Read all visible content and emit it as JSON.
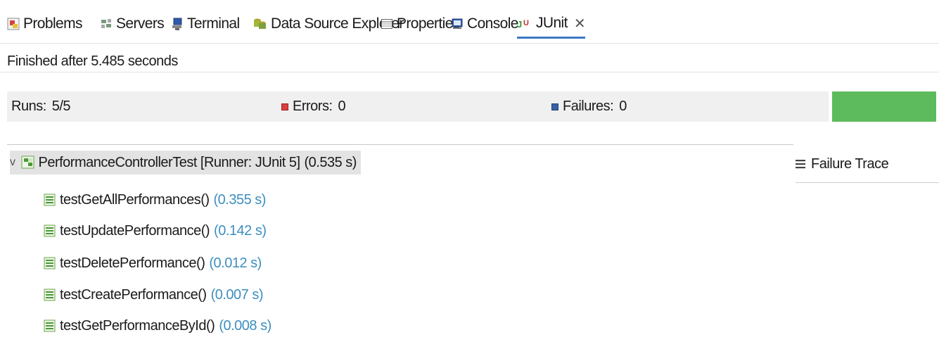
{
  "tabs": [
    {
      "label": "Problems",
      "icon": "problems-icon"
    },
    {
      "label": "Servers",
      "icon": "servers-icon"
    },
    {
      "label": "Terminal",
      "icon": "terminal-icon"
    },
    {
      "label": "Data Source Explorer",
      "icon": "data-source-icon"
    },
    {
      "label": "Properties",
      "icon": "properties-icon"
    },
    {
      "label": "Console",
      "icon": "console-icon"
    },
    {
      "label": "JUnit",
      "icon": "junit-icon",
      "active": true,
      "close": "✕"
    }
  ],
  "status": "Finished after 5.485 seconds",
  "counters": {
    "runs_label": "Runs:",
    "runs_value": "5/5",
    "errors_label": "Errors:",
    "errors_value": "0",
    "failures_label": "Failures:",
    "failures_value": "0"
  },
  "progress": {
    "fraction": 1.0,
    "color": "#5dbb5d"
  },
  "tree": {
    "root": {
      "label": "PerformanceControllerTest [Runner: JUnit 5]",
      "time": "(0.535 s)"
    },
    "tests": [
      {
        "name": "testGetAllPerformances()",
        "time": "(0.355 s)"
      },
      {
        "name": "testUpdatePerformance()",
        "time": "(0.142 s)"
      },
      {
        "name": "testDeletePerformance()",
        "time": "(0.012 s)"
      },
      {
        "name": "testCreatePerformance()",
        "time": "(0.007 s)"
      },
      {
        "name": "testGetPerformanceById()",
        "time": "(0.008 s)"
      }
    ]
  },
  "failure_trace": {
    "label": "Failure Trace",
    "icon": "stack-trace-icon"
  },
  "colors": {
    "accent": "#3b78c4",
    "time_text": "#3d8fbf",
    "pass": "#5dbb5d"
  }
}
